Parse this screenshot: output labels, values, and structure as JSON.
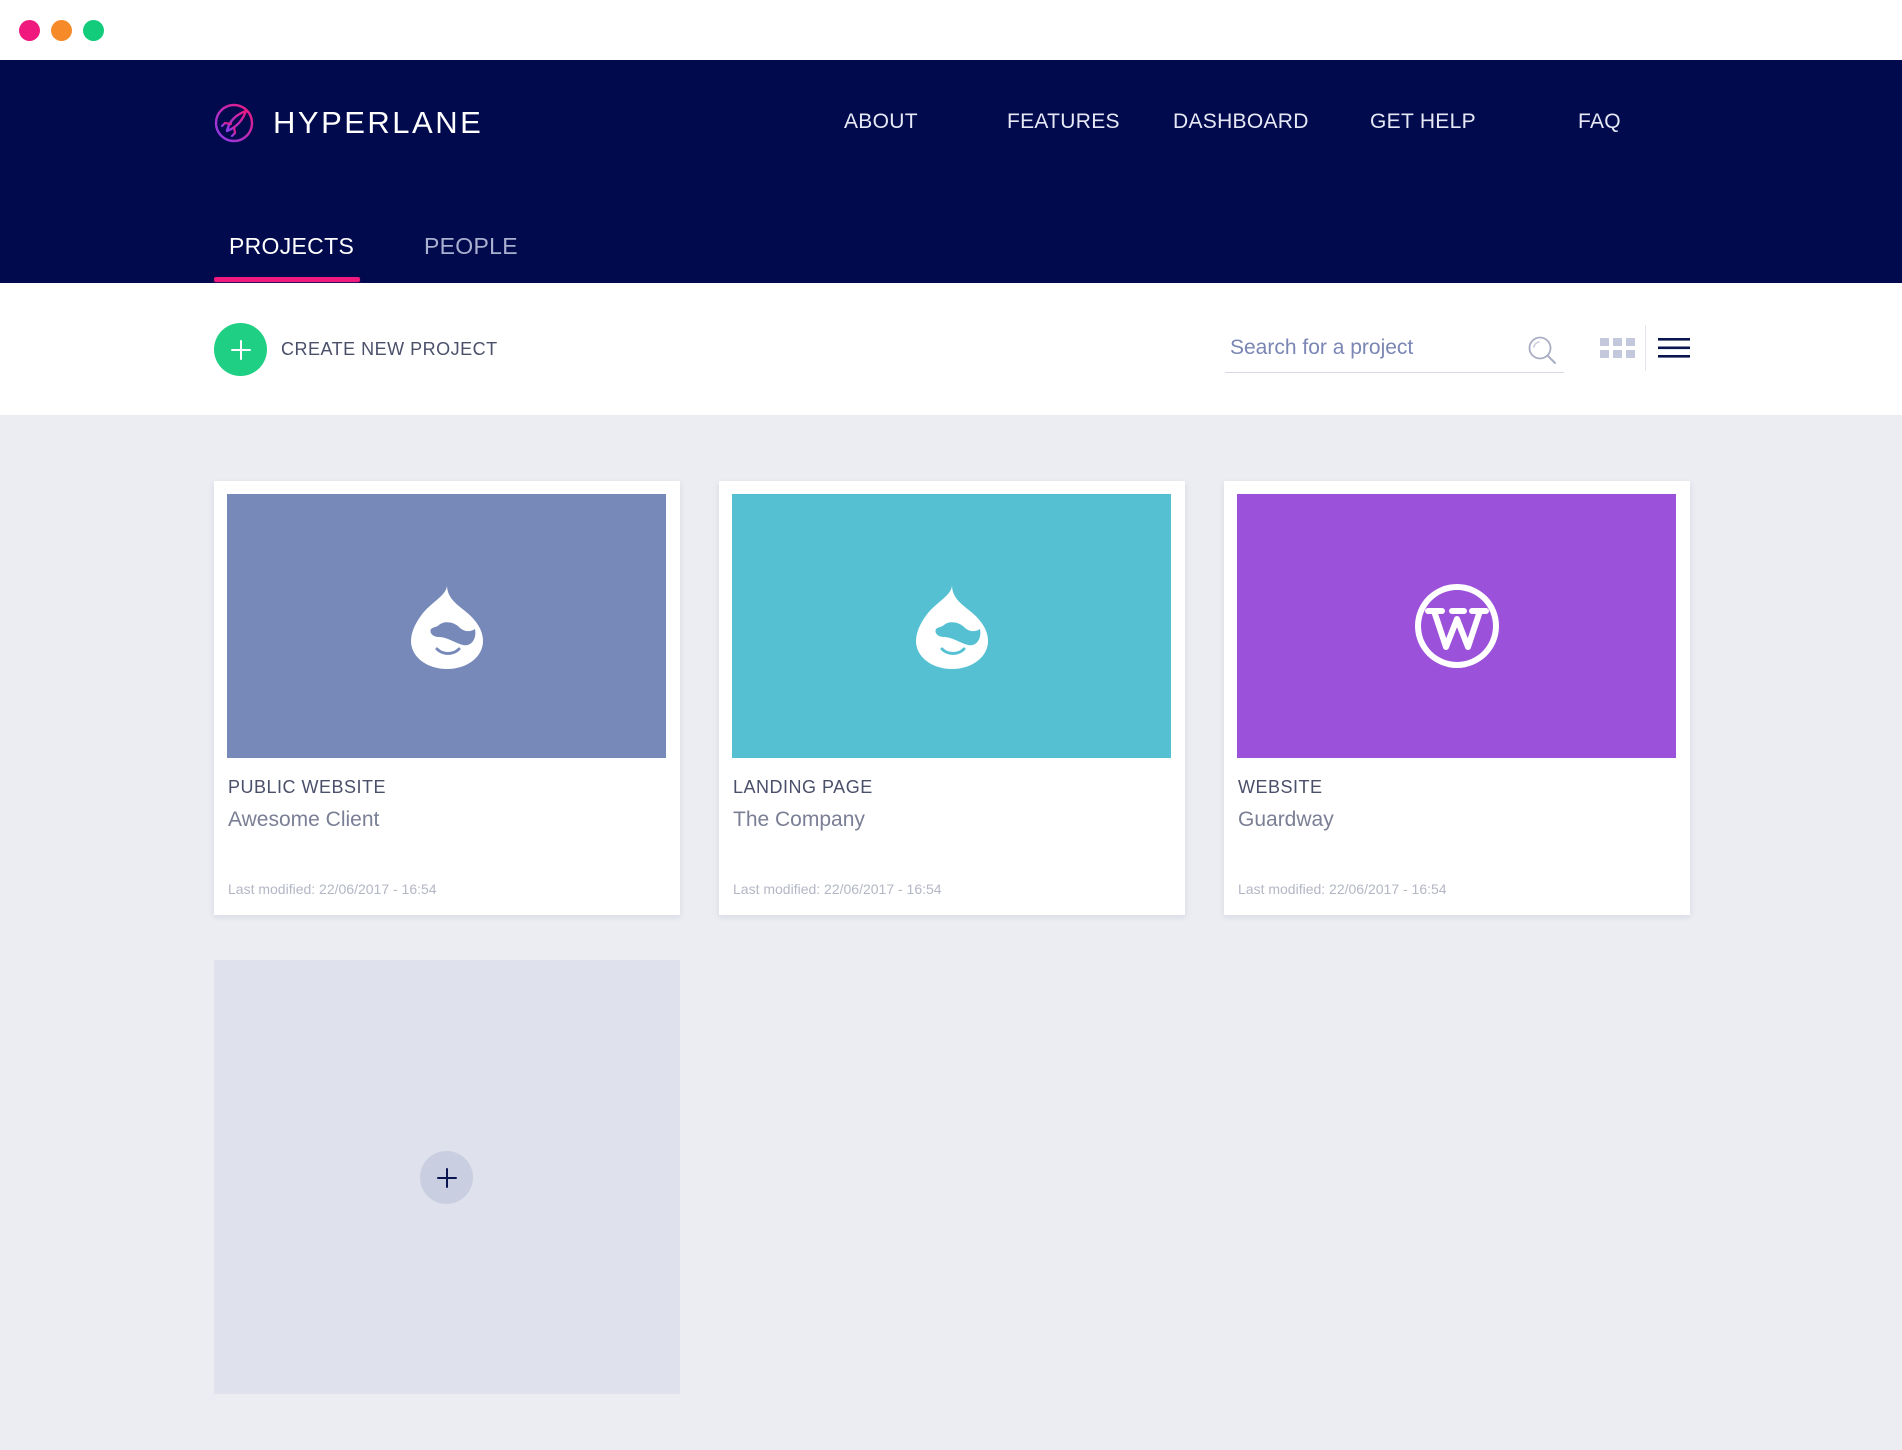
{
  "brand": {
    "name": "HYPERLANE"
  },
  "nav": {
    "items": [
      "ABOUT",
      "FEATURES",
      "DASHBOARD",
      "GET HELP",
      "FAQ"
    ]
  },
  "tabs": [
    {
      "label": "PROJECTS",
      "active": true
    },
    {
      "label": "PEOPLE",
      "active": false
    }
  ],
  "toolbar": {
    "create_label": "CREATE NEW PROJECT",
    "search_placeholder": "Search for a project"
  },
  "projects": [
    {
      "type": "PUBLIC WEBSITE",
      "client": "Awesome Client",
      "modified": "Last modified: 22/06/2017 - 16:54",
      "icon": "drupal-icon",
      "color": "#7789b8"
    },
    {
      "type": "LANDING PAGE",
      "client": "The Company",
      "modified": "Last modified: 22/06/2017 - 16:54",
      "icon": "drupal-icon",
      "color": "#56c0d3"
    },
    {
      "type": "WEBSITE",
      "client": "Guardway",
      "modified": "Last modified: 22/06/2017 - 16:54",
      "icon": "wordpress-icon",
      "color": "#9b51d9"
    }
  ],
  "colors": {
    "navbar": "#010a4d",
    "accent_pink": "#f0197d",
    "create_green": "#1fcf83",
    "content_bg": "#ebedf2"
  }
}
